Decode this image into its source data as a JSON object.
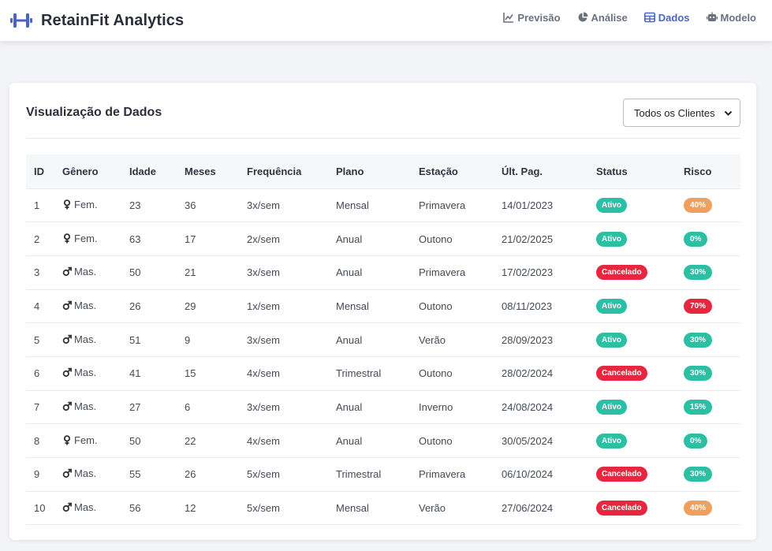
{
  "app": {
    "title": "RetainFit Analytics",
    "brand_icon": "dumbbell-icon"
  },
  "nav": {
    "items": [
      {
        "label": "Previsão",
        "icon": "chart-line-icon",
        "active": false
      },
      {
        "label": "Análise",
        "icon": "pie-chart-icon",
        "active": false
      },
      {
        "label": "Dados",
        "icon": "table-icon",
        "active": true
      },
      {
        "label": "Modelo",
        "icon": "robot-icon",
        "active": false
      }
    ]
  },
  "card": {
    "title": "Visualização de Dados",
    "filter": {
      "selected": "Todos os Clientes"
    }
  },
  "table": {
    "headers": [
      "ID",
      "Gênero",
      "Idade",
      "Meses",
      "Frequência",
      "Plano",
      "Estação",
      "Últ. Pag.",
      "Status",
      "Risco"
    ],
    "rows": [
      {
        "id": "1",
        "gender": "Fem.",
        "gender_icon": "female-icon",
        "age": "23",
        "months": "36",
        "freq": "3x/sem",
        "plan": "Mensal",
        "season": "Primavera",
        "last_pay": "14/01/2023",
        "status": "Ativo",
        "risk": "40%"
      },
      {
        "id": "2",
        "gender": "Fem.",
        "gender_icon": "female-icon",
        "age": "63",
        "months": "17",
        "freq": "2x/sem",
        "plan": "Anual",
        "season": "Outono",
        "last_pay": "21/02/2025",
        "status": "Ativo",
        "risk": "0%"
      },
      {
        "id": "3",
        "gender": "Mas.",
        "gender_icon": "male-icon",
        "age": "50",
        "months": "21",
        "freq": "3x/sem",
        "plan": "Anual",
        "season": "Primavera",
        "last_pay": "17/02/2023",
        "status": "Cancelado",
        "risk": "30%"
      },
      {
        "id": "4",
        "gender": "Mas.",
        "gender_icon": "male-icon",
        "age": "26",
        "months": "29",
        "freq": "1x/sem",
        "plan": "Mensal",
        "season": "Outono",
        "last_pay": "08/11/2023",
        "status": "Ativo",
        "risk": "70%"
      },
      {
        "id": "5",
        "gender": "Mas.",
        "gender_icon": "male-icon",
        "age": "51",
        "months": "9",
        "freq": "3x/sem",
        "plan": "Anual",
        "season": "Verão",
        "last_pay": "28/09/2023",
        "status": "Ativo",
        "risk": "30%"
      },
      {
        "id": "6",
        "gender": "Mas.",
        "gender_icon": "male-icon",
        "age": "41",
        "months": "15",
        "freq": "4x/sem",
        "plan": "Trimestral",
        "season": "Outono",
        "last_pay": "28/02/2024",
        "status": "Cancelado",
        "risk": "30%"
      },
      {
        "id": "7",
        "gender": "Mas.",
        "gender_icon": "male-icon",
        "age": "27",
        "months": "6",
        "freq": "3x/sem",
        "plan": "Anual",
        "season": "Inverno",
        "last_pay": "24/08/2024",
        "status": "Ativo",
        "risk": "15%"
      },
      {
        "id": "8",
        "gender": "Fem.",
        "gender_icon": "female-icon",
        "age": "50",
        "months": "22",
        "freq": "4x/sem",
        "plan": "Anual",
        "season": "Outono",
        "last_pay": "30/05/2024",
        "status": "Ativo",
        "risk": "0%"
      },
      {
        "id": "9",
        "gender": "Mas.",
        "gender_icon": "male-icon",
        "age": "55",
        "months": "26",
        "freq": "5x/sem",
        "plan": "Trimestral",
        "season": "Primavera",
        "last_pay": "06/10/2024",
        "status": "Cancelado",
        "risk": "30%"
      },
      {
        "id": "10",
        "gender": "Mas.",
        "gender_icon": "male-icon",
        "age": "56",
        "months": "12",
        "freq": "5x/sem",
        "plan": "Mensal",
        "season": "Verão",
        "last_pay": "27/06/2024",
        "status": "Cancelado",
        "risk": "40%"
      }
    ]
  },
  "colors": {
    "active_nav": "#4a63c9",
    "status_ativo": "#2bbfa4",
    "status_cancelado": "#e8263f",
    "risk_low": "#2bbfa4",
    "risk_medium": "#f0a05e",
    "risk_high": "#e8263f"
  }
}
